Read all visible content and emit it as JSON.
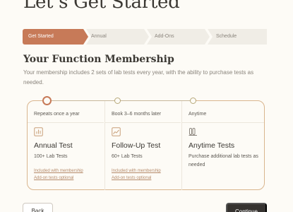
{
  "header": {
    "title": "Let’s Get Started"
  },
  "stepper": {
    "steps": [
      {
        "label": "Get Started",
        "active": true
      },
      {
        "label": "Annual",
        "active": false
      },
      {
        "label": "Add-Ons",
        "active": false
      },
      {
        "label": "Schedule",
        "active": false
      }
    ]
  },
  "section": {
    "title": "Your Function Membership",
    "description": "Your membership includes 2 sets of lab tests every year, with the ability to purchase tests as needed."
  },
  "timeline": {
    "columns": [
      {
        "timing": "Repeats once a year",
        "icon": "bar-chart-icon",
        "title": "Annual Test",
        "subtitle": "100+ Lab Tests",
        "link_1": "Included with membership",
        "link_2": "Add-on tests optional"
      },
      {
        "timing": "Book 3–6 months later",
        "icon": "trend-line-icon",
        "title": "Follow-Up Test",
        "subtitle": "60+ Lab Tests",
        "link_1": "Included with membership",
        "link_2": "Add-on tests optional"
      },
      {
        "timing": "Anytime",
        "icon": "test-tubes-icon",
        "title": "Anytime Tests",
        "subtitle": "Purchase additional lab tests as needed"
      }
    ]
  },
  "footer": {
    "back_label": "Back",
    "continue_label": "Continue"
  },
  "colors": {
    "accent": "#c77a58",
    "border": "#d9b58e",
    "dark": "#363330"
  }
}
